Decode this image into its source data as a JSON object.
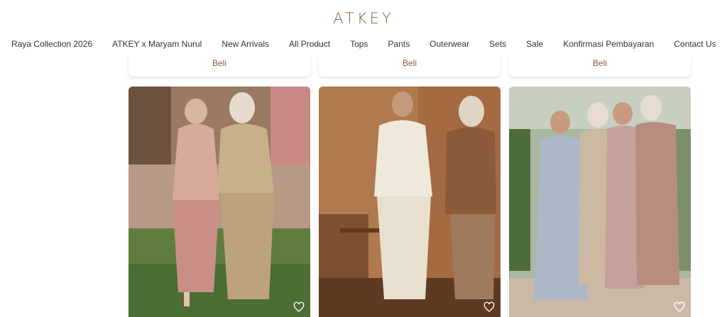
{
  "brand": {
    "logo_text": "ATKEY"
  },
  "nav": {
    "items": [
      "Raya Collection 2026",
      "ATKEY x Maryam Nurul",
      "New Arrivals",
      "All Product",
      "Tops",
      "Pants",
      "Outerwear",
      "Sets",
      "Sale",
      "Konfirmasi Pembayaran",
      "Contact Us"
    ]
  },
  "products_top": {
    "buy_labels": [
      "Beli",
      "Beli",
      "Beli"
    ]
  },
  "products": [
    {
      "image": "two women in pink and beige outfits walking on grass",
      "wishlist_icon": "heart-icon"
    },
    {
      "image": "two women in white and brown outfits near wooden wall",
      "wishlist_icon": "heart-icon"
    },
    {
      "image": "group of women in pastel dresses on a porch",
      "wishlist_icon": "heart-icon"
    }
  ]
}
